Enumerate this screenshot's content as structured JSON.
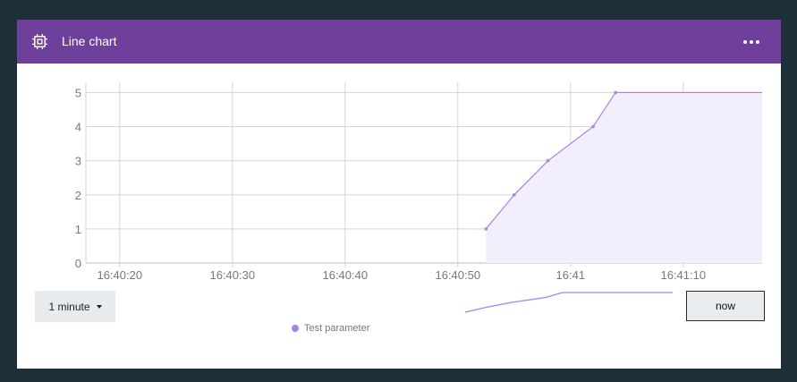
{
  "card": {
    "title": "Line chart",
    "icon": "chip-icon",
    "menu_icon": "more-horizontal-icon"
  },
  "controls": {
    "range_label": "1 minute",
    "now_label": "now"
  },
  "colors": {
    "header": "#6e3f9b",
    "series": "#a782e8",
    "fill": "#f3eefc",
    "grid": "#d6d6d6"
  },
  "chart_data": {
    "type": "area",
    "series": [
      {
        "name": "Test parameter",
        "x": [
          "16:40:52.5",
          "16:40:55",
          "16:40:58",
          "16:41:02",
          "16:41:04",
          "16:41:17"
        ],
        "values": [
          1,
          2,
          3,
          4,
          5,
          5
        ]
      }
    ],
    "x_ticks": [
      "16:40:20",
      "16:40:30",
      "16:40:40",
      "16:40:50",
      "16:41",
      "16:41:10"
    ],
    "y_ticks": [
      0,
      1,
      2,
      3,
      4,
      5
    ],
    "xlim": [
      "16:40:17",
      "16:41:17"
    ],
    "ylim": [
      0,
      5.3
    ],
    "grid": true,
    "legend": "bottom-center"
  }
}
